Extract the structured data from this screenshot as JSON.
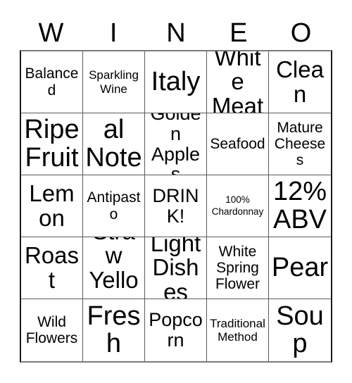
{
  "card": {
    "title_letters": [
      "W",
      "I",
      "N",
      "E",
      "O"
    ],
    "columns": 5,
    "rows": 5,
    "background_color": "#ffffff",
    "text_color": "#000000",
    "border_color": "#5a5a5a",
    "outer_border_color": "#1a1a1a"
  },
  "grid": {
    "rows": [
      {
        "cells": [
          {
            "text": "Balanced",
            "size": "sz-m"
          },
          {
            "text": "Sparkling Wine",
            "size": "sz-s"
          },
          {
            "text": "Italy",
            "size": "sz-xxl"
          },
          {
            "text": "White Meat",
            "size": "sz-xl"
          },
          {
            "text": "Clean",
            "size": "sz-xl"
          }
        ]
      },
      {
        "cells": [
          {
            "text": "Ripe Fruit",
            "size": "sz-xxl"
          },
          {
            "text": "Floral Notes",
            "size": "sz-xxl"
          },
          {
            "text": "Golden Apples",
            "size": "sz-l"
          },
          {
            "text": "Seafood",
            "size": "sz-m"
          },
          {
            "text": "Mature Cheeses",
            "size": "sz-m"
          }
        ]
      },
      {
        "cells": [
          {
            "text": "Lemon",
            "size": "sz-xl"
          },
          {
            "text": "Antipasto",
            "size": "sz-m"
          },
          {
            "text": "DRINK!",
            "size": "sz-l"
          },
          {
            "text": "100% Chardonnay",
            "size": "sz-xs"
          },
          {
            "text": "12% ABV",
            "size": "sz-xxl"
          }
        ]
      },
      {
        "cells": [
          {
            "text": "Roast",
            "size": "sz-xl"
          },
          {
            "text": "Straw Yellow",
            "size": "sz-xl"
          },
          {
            "text": "Light Dishes",
            "size": "sz-xl"
          },
          {
            "text": "White Spring Flower",
            "size": "sz-m"
          },
          {
            "text": "Pear",
            "size": "sz-xxl"
          }
        ]
      },
      {
        "cells": [
          {
            "text": "Wild Flowers",
            "size": "sz-m"
          },
          {
            "text": "Fresh",
            "size": "sz-xxl"
          },
          {
            "text": "Popcorn",
            "size": "sz-l"
          },
          {
            "text": "Traditional Method",
            "size": "sz-s"
          },
          {
            "text": "Soup",
            "size": "sz-xxl"
          }
        ]
      }
    ]
  }
}
